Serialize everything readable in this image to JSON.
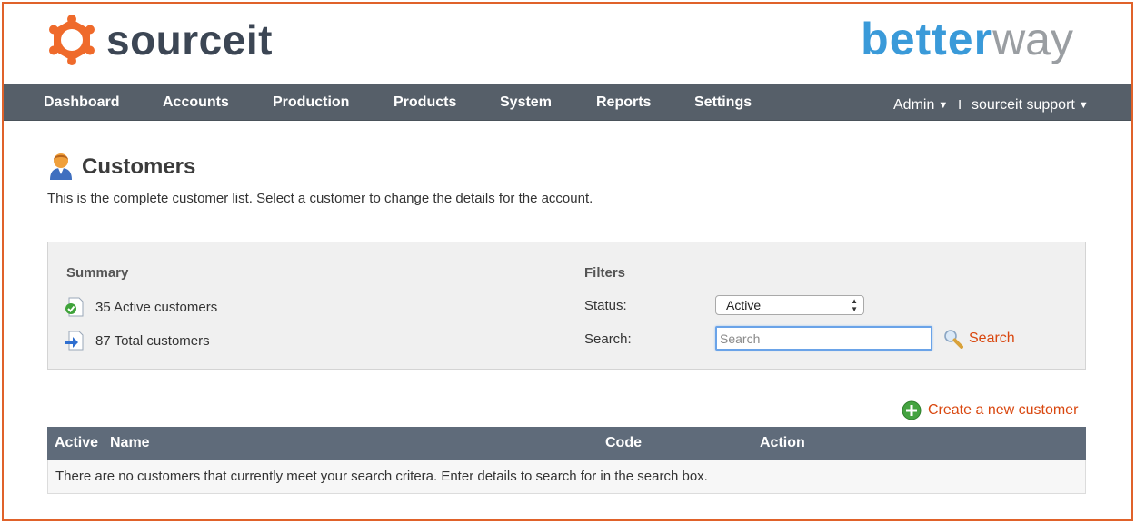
{
  "header": {
    "brand_left": "sourceit",
    "brand_right_part1": "better",
    "brand_right_part2": "way"
  },
  "nav": {
    "items": [
      {
        "label": "Dashboard"
      },
      {
        "label": "Accounts"
      },
      {
        "label": "Production"
      },
      {
        "label": "Products"
      },
      {
        "label": "System"
      },
      {
        "label": "Reports"
      },
      {
        "label": "Settings"
      }
    ],
    "admin_label": "Admin",
    "separator": "I",
    "support_label": "sourceit support"
  },
  "page": {
    "title": "Customers",
    "description": "This is the complete customer list. Select a customer to change the details for the account."
  },
  "summary": {
    "heading": "Summary",
    "active": "35 Active customers",
    "total": "87 Total customers"
  },
  "filters": {
    "heading": "Filters",
    "status_label": "Status:",
    "status_value": "Active",
    "search_label": "Search:",
    "search_placeholder": "Search",
    "search_value": "",
    "search_button": "Search"
  },
  "create_label": "Create a new customer",
  "table": {
    "columns": [
      "Active",
      "Name",
      "Code",
      "Action"
    ],
    "empty_message": "There are no customers that currently meet your search critera. Enter details to search for in the search box."
  },
  "colors": {
    "accent": "#d9470f",
    "navbar": "#565f69",
    "table_header": "#5f6b7a",
    "frame_border": "#e0622a",
    "brand_blue": "#3a9ad9",
    "brand_orange": "#ef6a2b"
  },
  "icons": {
    "logo": "sourceit-gear-logo",
    "page": "customer-person-icon",
    "active": "check-document-icon",
    "total": "arrow-document-icon",
    "search": "magnifier-icon",
    "create": "plus-circle-icon"
  }
}
